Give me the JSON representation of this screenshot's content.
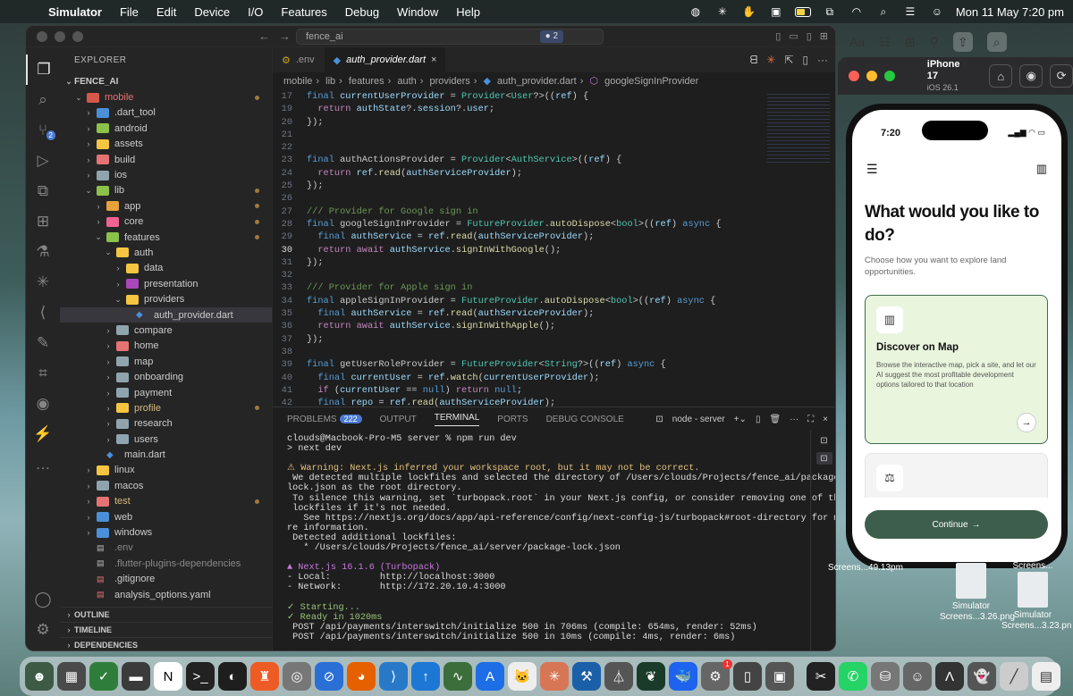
{
  "menubar": {
    "app": "Simulator",
    "items": [
      "File",
      "Edit",
      "Device",
      "I/O",
      "Features",
      "Debug",
      "Window",
      "Help"
    ],
    "datetime": "Mon 11 May  7:20 pm"
  },
  "vscode": {
    "search": "fence_ai",
    "search_count": "2",
    "explorer_title": "EXPLORER",
    "root": "FENCE_AI",
    "tree": [
      {
        "label": "mobile",
        "depth": 1,
        "type": "folder-open",
        "color": "#d6584a",
        "dot": true
      },
      {
        "label": ".dart_tool",
        "depth": 2,
        "type": "folder",
        "color": "#4b8fd9"
      },
      {
        "label": "android",
        "depth": 2,
        "type": "folder",
        "color": "#8bc34a"
      },
      {
        "label": "assets",
        "depth": 2,
        "type": "folder",
        "color": "#f5c542"
      },
      {
        "label": "build",
        "depth": 2,
        "type": "folder",
        "color": "#e57373"
      },
      {
        "label": "ios",
        "depth": 2,
        "type": "folder",
        "color": "#90a4ae"
      },
      {
        "label": "lib",
        "depth": 2,
        "type": "folder-open",
        "color": "#8bc34a",
        "dot": true
      },
      {
        "label": "app",
        "depth": 3,
        "type": "folder",
        "color": "#e8a23b",
        "dot": true
      },
      {
        "label": "core",
        "depth": 3,
        "type": "folder",
        "color": "#f06292",
        "dot": true
      },
      {
        "label": "features",
        "depth": 3,
        "type": "folder-open",
        "color": "#8bc34a",
        "dot": true
      },
      {
        "label": "auth",
        "depth": 4,
        "type": "folder-open",
        "color": "#f5c542"
      },
      {
        "label": "data",
        "depth": 5,
        "type": "folder",
        "color": "#f5c542"
      },
      {
        "label": "presentation",
        "depth": 5,
        "type": "folder",
        "color": "#ab47bc"
      },
      {
        "label": "providers",
        "depth": 5,
        "type": "folder-open",
        "color": "#f5c542"
      },
      {
        "label": "auth_provider.dart",
        "depth": 6,
        "type": "dart",
        "color": "#4b8fd9",
        "selected": true
      },
      {
        "label": "compare",
        "depth": 4,
        "type": "folder",
        "color": "#90a4ae"
      },
      {
        "label": "home",
        "depth": 4,
        "type": "folder",
        "color": "#e57373"
      },
      {
        "label": "map",
        "depth": 4,
        "type": "folder",
        "color": "#90a4ae"
      },
      {
        "label": "onboarding",
        "depth": 4,
        "type": "folder",
        "color": "#90a4ae"
      },
      {
        "label": "payment",
        "depth": 4,
        "type": "folder",
        "color": "#90a4ae"
      },
      {
        "label": "profile",
        "depth": 4,
        "type": "folder",
        "color": "#f5c542",
        "dot": true,
        "warn": true
      },
      {
        "label": "research",
        "depth": 4,
        "type": "folder",
        "color": "#90a4ae"
      },
      {
        "label": "users",
        "depth": 4,
        "type": "folder",
        "color": "#90a4ae"
      },
      {
        "label": "main.dart",
        "depth": 3,
        "type": "dart",
        "color": "#4b8fd9"
      },
      {
        "label": "linux",
        "depth": 2,
        "type": "folder",
        "color": "#f5c542"
      },
      {
        "label": "macos",
        "depth": 2,
        "type": "folder",
        "color": "#90a4ae"
      },
      {
        "label": "test",
        "depth": 2,
        "type": "folder",
        "color": "#e57373",
        "dot": true,
        "warn": true
      },
      {
        "label": "web",
        "depth": 2,
        "type": "folder",
        "color": "#4b8fd9"
      },
      {
        "label": "windows",
        "depth": 2,
        "type": "folder",
        "color": "#4b8fd9"
      },
      {
        "label": ".env",
        "depth": 2,
        "type": "file",
        "color": "#bbb",
        "muted": true
      },
      {
        "label": ".flutter-plugins-dependencies",
        "depth": 2,
        "type": "file",
        "color": "#bbb",
        "muted": true
      },
      {
        "label": ".gitignore",
        "depth": 2,
        "type": "file",
        "color": "#e57373"
      },
      {
        "label": "analysis_options.yaml",
        "depth": 2,
        "type": "file",
        "color": "#e57373"
      }
    ],
    "sections": [
      "OUTLINE",
      "TIMELINE",
      "DEPENDENCIES"
    ],
    "tabs": [
      ".env",
      "auth_provider.dart"
    ],
    "breadcrumb": [
      "mobile",
      "lib",
      "features",
      "auth",
      "providers",
      "auth_provider.dart",
      "googleSignInProvider"
    ],
    "code_lines": [
      {
        "n": "17",
        "t": "final currentUserProvider = Provider<User?>((ref) {"
      },
      {
        "n": "19",
        "t": "  return authState?.session?.user;"
      },
      {
        "n": "20",
        "t": "});"
      },
      {
        "n": "21",
        "t": ""
      },
      {
        "n": "22",
        "t": ""
      },
      {
        "n": "23",
        "t": "final authActionsProvider = Provider<AuthService>((ref) {"
      },
      {
        "n": "24",
        "t": "  return ref.read(authServiceProvider);"
      },
      {
        "n": "25",
        "t": "});"
      },
      {
        "n": "26",
        "t": ""
      },
      {
        "n": "27",
        "t": "/// Provider for Google sign in"
      },
      {
        "n": "28",
        "t": "final googleSignInProvider = FutureProvider.autoDispose<bool>((ref) async {"
      },
      {
        "n": "29",
        "t": "  final authService = ref.read(authServiceProvider);"
      },
      {
        "n": "30",
        "t": "  return await authService.signInWithGoogle();"
      },
      {
        "n": "31",
        "t": "});"
      },
      {
        "n": "32",
        "t": ""
      },
      {
        "n": "33",
        "t": "/// Provider for Apple sign in"
      },
      {
        "n": "34",
        "t": "final appleSignInProvider = FutureProvider.autoDispose<bool>((ref) async {"
      },
      {
        "n": "35",
        "t": "  final authService = ref.read(authServiceProvider);"
      },
      {
        "n": "36",
        "t": "  return await authService.signInWithApple();"
      },
      {
        "n": "37",
        "t": "});"
      },
      {
        "n": "38",
        "t": ""
      },
      {
        "n": "39",
        "t": "final getUserRoleProvider = FutureProvider<String?>((ref) async {"
      },
      {
        "n": "40",
        "t": "  final currentUser = ref.watch(currentUserProvider);"
      },
      {
        "n": "41",
        "t": "  if (currentUser == null) return null;"
      },
      {
        "n": "42",
        "t": "  final repo = ref.read(authServiceProvider);"
      }
    ],
    "current_line": "30",
    "panel_tabs": [
      "PROBLEMS",
      "OUTPUT",
      "TERMINAL",
      "PORTS",
      "DEBUG CONSOLE"
    ],
    "problems_count": "222",
    "terminal_session": "node - server",
    "terminal_lines": [
      {
        "c": "",
        "t": "clouds@Macbook-Pro-M5 server % npm run dev"
      },
      {
        "c": "",
        "t": "> next dev"
      },
      {
        "c": "",
        "t": ""
      },
      {
        "c": "y",
        "t": "⚠ Warning: Next.js inferred your workspace root, but it may not be correct."
      },
      {
        "c": "",
        "t": " We detected multiple lockfiles and selected the directory of /Users/clouds/Projects/fence_ai/package-"
      },
      {
        "c": "",
        "t": "lock.json as the root directory."
      },
      {
        "c": "",
        "t": " To silence this warning, set `turbopack.root` in your Next.js config, or consider removing one of the"
      },
      {
        "c": "",
        "t": " lockfiles if it's not needed."
      },
      {
        "c": "",
        "t": "   See https://nextjs.org/docs/app/api-reference/config/next-config-js/turbopack#root-directory for mo"
      },
      {
        "c": "",
        "t": "re information."
      },
      {
        "c": "",
        "t": " Detected additional lockfiles:"
      },
      {
        "c": "",
        "t": "   * /Users/clouds/Projects/fence_ai/server/package-lock.json"
      },
      {
        "c": "",
        "t": ""
      },
      {
        "c": "m",
        "t": "▲ Next.js 16.1.6 (Turbopack)"
      },
      {
        "c": "",
        "t": "- Local:         http://localhost:3000"
      },
      {
        "c": "",
        "t": "- Network:       http://172.20.10.4:3000"
      },
      {
        "c": "",
        "t": ""
      },
      {
        "c": "g",
        "t": "✓ Starting..."
      },
      {
        "c": "g",
        "t": "✓ Ready in 1020ms"
      },
      {
        "c": "",
        "t": " POST /api/payments/interswitch/initialize 500 in 706ms (compile: 654ms, render: 52ms)"
      },
      {
        "c": "",
        "t": " POST /api/payments/interswitch/initialize 500 in 10ms (compile: 4ms, render: 6ms)"
      }
    ]
  },
  "simulator": {
    "device": "iPhone 17",
    "os": "iOS 26.1"
  },
  "app_screen": {
    "time": "7:20",
    "heading": "What would you like to do?",
    "subheading": "Choose how you want to explore land opportunities.",
    "card1_title": "Discover on Map",
    "card1_desc": "Browse the interactive map, pick a site, and let our AI suggest the most profitable development options tailored to that location",
    "continue": "Continue"
  },
  "desktop_files": [
    {
      "label": "Simulator Screens...3.26.png"
    },
    {
      "label": "Simulator Screens...3.23.pn"
    },
    {
      "label": "Screens...49.13pm"
    },
    {
      "label": "Screens..."
    }
  ],
  "colors": {
    "accent": "#3e5e4d",
    "card_bg": "#e9f5dd",
    "vscode_bg": "#1e1e1e"
  }
}
